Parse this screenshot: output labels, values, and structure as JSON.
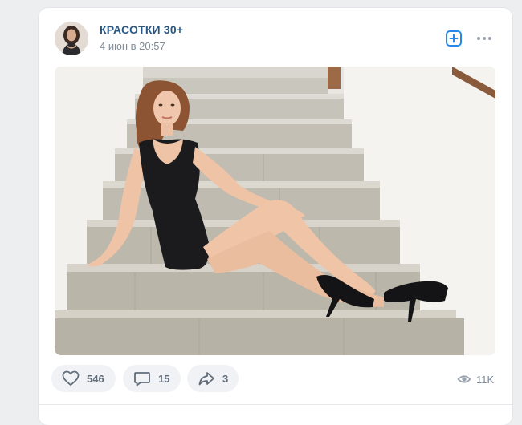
{
  "post": {
    "author": {
      "name": "КРАСОТКИ 30+",
      "avatar_icon": "avatar-woman-photo"
    },
    "date": "4 июн в 20:57",
    "header_actions": {
      "subscribe_icon": "plus-square-icon",
      "more_icon": "more-dots-icon"
    },
    "photo": {
      "description_icon": "photo-woman-on-stairs"
    },
    "actions": {
      "likes": "546",
      "comments": "15",
      "shares": "3"
    },
    "views": "11K"
  },
  "colors": {
    "background": "#edeef0",
    "link": "#2a5885",
    "secondary_text": "#818c99",
    "accent": "#2688eb",
    "button_bg": "#f0f2f5",
    "button_text": "#626d7a"
  }
}
